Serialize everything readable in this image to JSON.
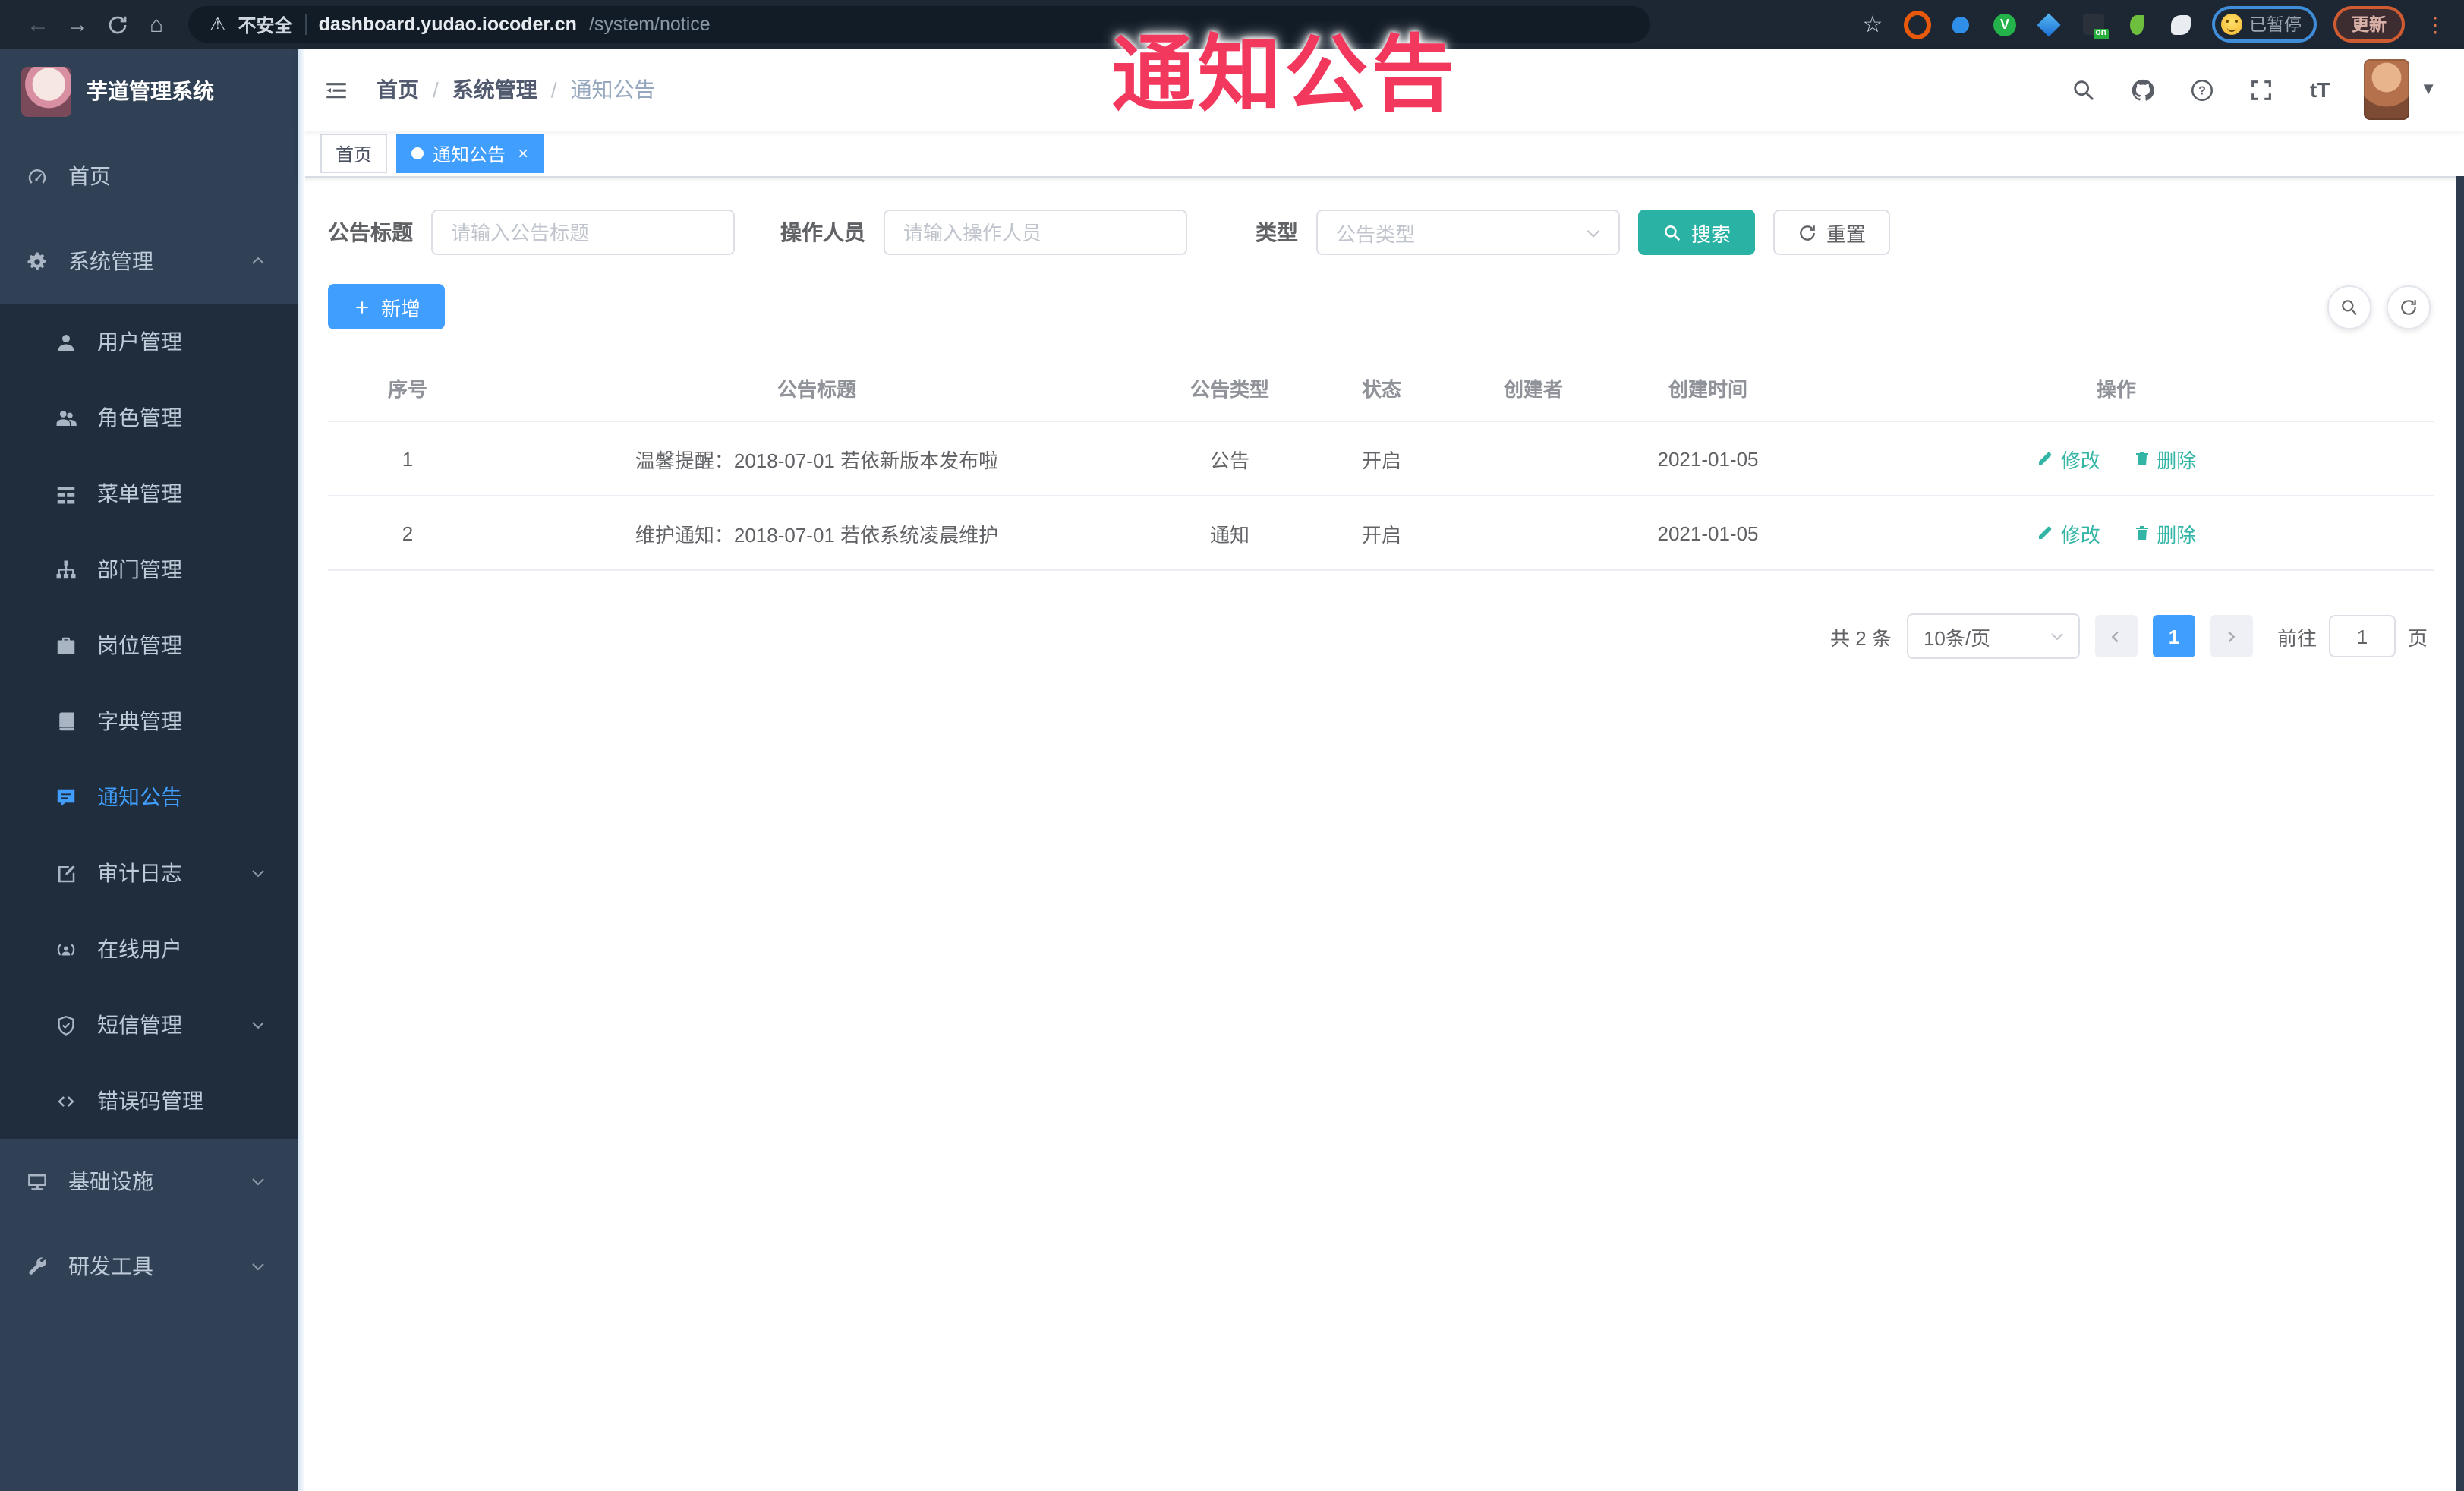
{
  "annotation": {
    "text": "通知公告"
  },
  "browser": {
    "security_label": "不安全",
    "url_host": "dashboard.yudao.iocoder.cn",
    "url_path": "/system/notice",
    "extension_badge": "on",
    "paused_label": "已暂停",
    "update_label": "更新"
  },
  "sidebar": {
    "title": "芋道管理系统",
    "items": [
      {
        "label": "首页",
        "icon": "dashboard-icon"
      },
      {
        "label": "系统管理",
        "icon": "gear-icon",
        "expanded": true
      },
      {
        "label": "用户管理",
        "icon": "user-icon",
        "child": true
      },
      {
        "label": "角色管理",
        "icon": "roles-icon",
        "child": true
      },
      {
        "label": "菜单管理",
        "icon": "menu-list-icon",
        "child": true
      },
      {
        "label": "部门管理",
        "icon": "org-tree-icon",
        "child": true
      },
      {
        "label": "岗位管理",
        "icon": "briefcase-icon",
        "child": true
      },
      {
        "label": "字典管理",
        "icon": "dictionary-icon",
        "child": true
      },
      {
        "label": "通知公告",
        "icon": "notice-icon",
        "child": true,
        "active": true
      },
      {
        "label": "审计日志",
        "icon": "audit-log-icon",
        "child": true,
        "expandable": true
      },
      {
        "label": "在线用户",
        "icon": "online-users-icon",
        "child": true
      },
      {
        "label": "短信管理",
        "icon": "sms-shield-icon",
        "child": true,
        "expandable": true
      },
      {
        "label": "错误码管理",
        "icon": "error-code-icon",
        "child": true
      },
      {
        "label": "基础设施",
        "icon": "monitor-icon",
        "expandable": true
      },
      {
        "label": "研发工具",
        "icon": "wrench-icon",
        "expandable": true
      }
    ]
  },
  "header": {
    "breadcrumb": [
      "首页",
      "系统管理",
      "通知公告"
    ],
    "breadcrumb_separator": "/",
    "font_size_icon_text": "tT"
  },
  "tags": [
    {
      "label": "首页"
    },
    {
      "label": "通知公告",
      "active": true
    }
  ],
  "filters": {
    "title_label": "公告标题",
    "title_placeholder": "请输入公告标题",
    "operator_label": "操作人员",
    "operator_placeholder": "请输入操作人员",
    "type_label": "类型",
    "type_placeholder": "公告类型",
    "search_label": "搜索",
    "reset_label": "重置"
  },
  "toolbar": {
    "add_label": "新增"
  },
  "table": {
    "columns": [
      "序号",
      "公告标题",
      "公告类型",
      "状态",
      "创建者",
      "创建时间",
      "操作"
    ],
    "actions": {
      "edit": "修改",
      "delete": "删除"
    },
    "rows": [
      {
        "seq": "1",
        "title": "温馨提醒：2018-07-01 若依新版本发布啦",
        "type": "公告",
        "status": "开启",
        "creator": "",
        "created": "2021-01-05"
      },
      {
        "seq": "2",
        "title": "维护通知：2018-07-01 若依系统凌晨维护",
        "type": "通知",
        "status": "开启",
        "creator": "",
        "created": "2021-01-05"
      }
    ]
  },
  "pagination": {
    "total": "共 2 条",
    "page_size": "10条/页",
    "page": "1",
    "goto_label": "前往",
    "goto_value": "1",
    "unit_label": "页"
  },
  "colors": {
    "accent_blue": "#409EFF",
    "theme_teal": "#2AB3A4",
    "sidebar_bg": "#304156",
    "submenu_bg": "#1F2D3D",
    "annotation_red": "#F3385E"
  }
}
